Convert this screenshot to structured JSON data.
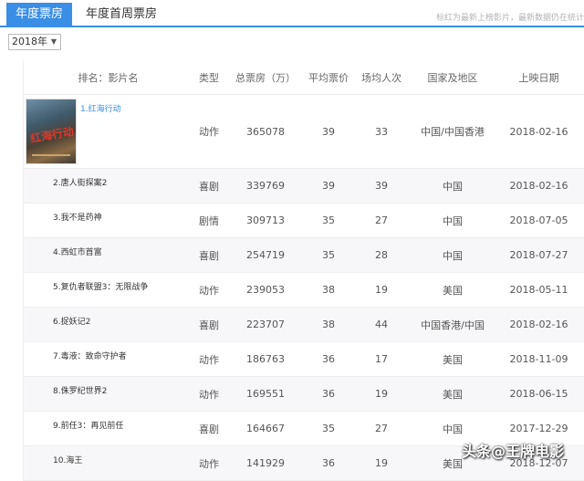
{
  "tabs": [
    {
      "label": "年度票房"
    },
    {
      "label": "年度首周票房"
    }
  ],
  "note": "标红为最新上榜影片，最新数据仍在统计",
  "year_select": {
    "value": "2018年"
  },
  "table": {
    "headers": {
      "rank_title": "排名：影片名",
      "type": "类型",
      "gross": "总票房（万）",
      "avg_price": "平均票价",
      "audience": "场均人次",
      "country": "国家及地区",
      "date": "上映日期"
    },
    "rows": [
      {
        "title": "1.红海行动",
        "type": "动作",
        "gross": "365078",
        "avg_price": "39",
        "audience": "33",
        "country": "中国/中国香港",
        "date": "2018-02-16"
      },
      {
        "title": "2.唐人街探案2",
        "type": "喜剧",
        "gross": "339769",
        "avg_price": "39",
        "audience": "39",
        "country": "中国",
        "date": "2018-02-16"
      },
      {
        "title": "3.我不是药神",
        "type": "剧情",
        "gross": "309713",
        "avg_price": "35",
        "audience": "27",
        "country": "中国",
        "date": "2018-07-05"
      },
      {
        "title": "4.西虹市首富",
        "type": "喜剧",
        "gross": "254719",
        "avg_price": "35",
        "audience": "28",
        "country": "中国",
        "date": "2018-07-27"
      },
      {
        "title": "5.复仇者联盟3：无限战争",
        "type": "动作",
        "gross": "239053",
        "avg_price": "38",
        "audience": "19",
        "country": "美国",
        "date": "2018-05-11"
      },
      {
        "title": "6.捉妖记2",
        "type": "喜剧",
        "gross": "223707",
        "avg_price": "38",
        "audience": "44",
        "country": "中国香港/中国",
        "date": "2018-02-16"
      },
      {
        "title": "7.毒液：致命守护者",
        "type": "动作",
        "gross": "186763",
        "avg_price": "36",
        "audience": "17",
        "country": "美国",
        "date": "2018-11-09"
      },
      {
        "title": "8.侏罗纪世界2",
        "type": "动作",
        "gross": "169551",
        "avg_price": "36",
        "audience": "19",
        "country": "美国",
        "date": "2018-06-15"
      },
      {
        "title": "9.前任3：再见前任",
        "type": "喜剧",
        "gross": "164667",
        "avg_price": "35",
        "audience": "27",
        "country": "中国",
        "date": "2017-12-29"
      },
      {
        "title": "10.海王",
        "type": "动作",
        "gross": "141929",
        "avg_price": "36",
        "audience": "19",
        "country": "美国",
        "date": "2018-12-07"
      }
    ]
  },
  "poster": {
    "text": "红海行动"
  },
  "watermark": "头条@王牌电影",
  "colors": {
    "accent": "#3a8ee6",
    "row_alt": "#f7f7fa"
  }
}
